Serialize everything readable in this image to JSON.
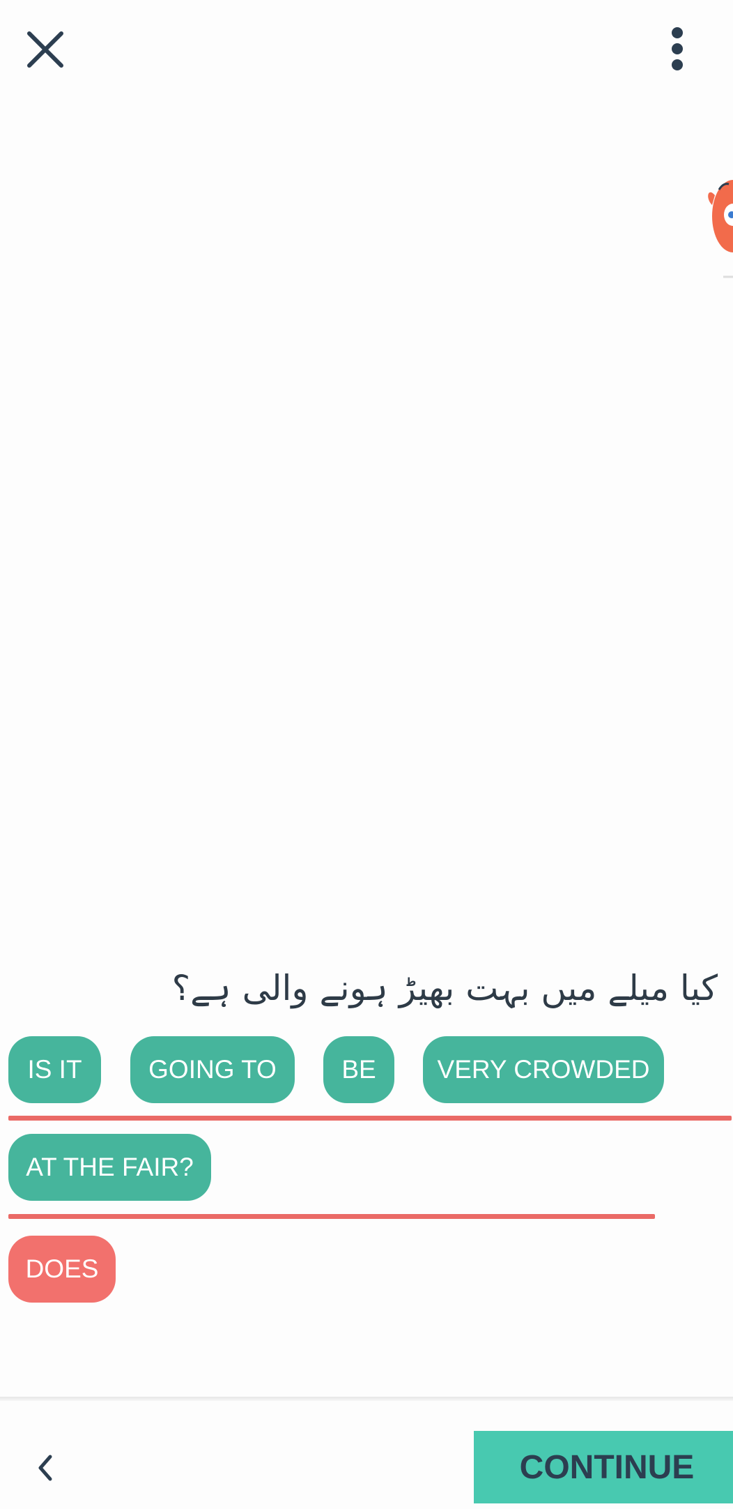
{
  "header": {
    "close_icon": "close-icon",
    "menu_icon": "more-vertical-icon"
  },
  "mascot": {
    "icon": "mascot-character",
    "color": "#f26b4b"
  },
  "prompt": {
    "text": "کیا میلے میں بہت بھیڑ ہونے والی ہے؟"
  },
  "answer_rows": [
    {
      "chips": [
        "IS IT",
        "GOING TO",
        "BE",
        "VERY CROWDED"
      ]
    },
    {
      "chips": [
        "AT THE FAIR?"
      ]
    }
  ],
  "word_bank": [
    {
      "label": "DOES",
      "status": "wrong"
    }
  ],
  "footer": {
    "back_icon": "chevron-left-icon",
    "continue_label": "CONTINUE"
  },
  "colors": {
    "chip": "#46b59c",
    "chip_wrong": "#f2716d",
    "underline": "#ea6a66",
    "continue": "#48c9b0",
    "text_dark": "#2c3e50"
  }
}
